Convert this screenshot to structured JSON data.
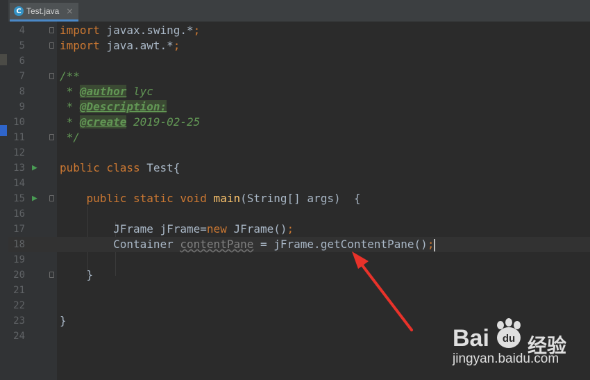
{
  "tab": {
    "icon": "java-class-icon",
    "icon_letter": "C",
    "label": "Test.java",
    "close": "×"
  },
  "lines": [
    {
      "n": "4"
    },
    {
      "n": "5"
    },
    {
      "n": "6"
    },
    {
      "n": "7"
    },
    {
      "n": "8"
    },
    {
      "n": "9"
    },
    {
      "n": "10"
    },
    {
      "n": "11"
    },
    {
      "n": "12"
    },
    {
      "n": "13"
    },
    {
      "n": "14"
    },
    {
      "n": "15"
    },
    {
      "n": "16"
    },
    {
      "n": "17"
    },
    {
      "n": "18"
    },
    {
      "n": "19"
    },
    {
      "n": "20"
    },
    {
      "n": "21"
    },
    {
      "n": "22"
    },
    {
      "n": "23"
    },
    {
      "n": "24"
    }
  ],
  "code": {
    "l4_kw": "import",
    "l4_rest": " javax.swing.*",
    "l4_semi": ";",
    "l5_kw": "import",
    "l5_rest": " java.awt.*",
    "l5_semi": ";",
    "l7": "/**",
    "l8_star": " * ",
    "l8_tag": "@author",
    "l8_val": " lyc",
    "l9_star": " * ",
    "l9_tag": "@Description:",
    "l10_star": " * ",
    "l10_tag": "@create",
    "l10_val": " 2019-02-25",
    "l11": " */",
    "l13_kw": "public class",
    "l13_rest": " Test{",
    "l15_kw": "    public static void",
    "l15_fn": " main",
    "l15_rest": "(String[] args)  {",
    "l17_pre": "        JFrame jFrame=",
    "l17_kw": "new",
    "l17_post": " JFrame()",
    "l17_semi": ";",
    "l18_pre": "        Container ",
    "l18_var": "contentPane",
    "l18_post": " = jFrame.getContentPane()",
    "l18_semi": ";",
    "l20": "    }",
    "l23": "}"
  },
  "watermark": {
    "brand": "Bai",
    "brand_paw": "du",
    "jingyan": "经验",
    "url": "jingyan.baidu.com"
  },
  "colors": {
    "keyword": "#cc7832",
    "comment": "#629755",
    "method": "#ffc66d",
    "text": "#a9b7c6",
    "arrow": "#e8322a"
  }
}
